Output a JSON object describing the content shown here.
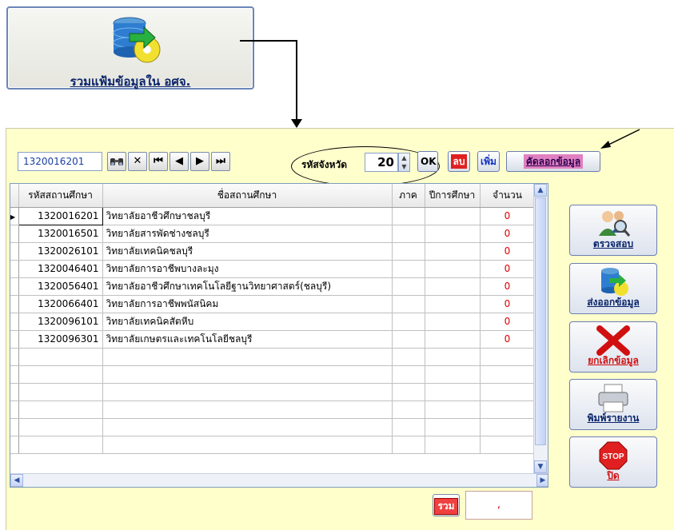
{
  "top_button": {
    "label": "รวมแฟ้มข้อมูลใน อศจ.",
    "icon": "database-export-icon"
  },
  "toolbar": {
    "record_value": "1320016201",
    "find_icon": "binoculars-icon",
    "delete_icon": "x-icon",
    "first_icon": "first-record-icon",
    "prev_icon": "prev-record-icon",
    "next_icon": "next-record-icon",
    "last_icon": "last-record-icon",
    "province_label": "รหัสจังหวัด",
    "province_value": "20",
    "ok_label": "OK",
    "delete_label": "ลบ",
    "add_label": "เพิ่ม",
    "export_label": "คัดลอกข้อมูล"
  },
  "grid": {
    "columns": [
      "รหัสสถานศึกษา",
      "ชื่อสถานศึกษา",
      "ภาค",
      "ปีการศึกษา",
      "จำนวน"
    ],
    "rows": [
      {
        "code": "1320016201",
        "name": "วิทยาลัยอาชีวศึกษาชลบุรี",
        "region": "",
        "year": "",
        "count": "0"
      },
      {
        "code": "1320016501",
        "name": "วิทยาลัยสารพัดช่างชลบุรี",
        "region": "",
        "year": "",
        "count": "0"
      },
      {
        "code": "1320026101",
        "name": "วิทยาลัยเทคนิคชลบุรี",
        "region": "",
        "year": "",
        "count": "0"
      },
      {
        "code": "1320046401",
        "name": "วิทยาลัยการอาชีพบางละมุง",
        "region": "",
        "year": "",
        "count": "0"
      },
      {
        "code": "1320056401",
        "name": "วิทยาลัยอาชีวศึกษาเทคโนโลยีฐานวิทยาศาสตร์(ชลบุรี)",
        "region": "",
        "year": "",
        "count": "0"
      },
      {
        "code": "1320066401",
        "name": "วิทยาลัยการอาชีพพนัสนิคม",
        "region": "",
        "year": "",
        "count": "0"
      },
      {
        "code": "1320096101",
        "name": "วิทยาลัยเทคนิคสัตหีบ",
        "region": "",
        "year": "",
        "count": "0"
      },
      {
        "code": "1320096301",
        "name": "วิทยาลัยเกษตรและเทคโนโลยีชลบุรี",
        "region": "",
        "year": "",
        "count": "0"
      }
    ]
  },
  "side_buttons": [
    {
      "label": "ตรวจสอบ",
      "icon": "users-search-icon"
    },
    {
      "label": "ส่งออกข้อมูล",
      "icon": "database-export-icon"
    },
    {
      "label": "ยกเลิกข้อมูล",
      "icon": "red-x-icon"
    },
    {
      "label": "พิมพ์รายงาน",
      "icon": "printer-icon"
    },
    {
      "label": "ปิด",
      "icon": "stop-sign-icon"
    }
  ],
  "footer": {
    "sum_label": "รวม",
    "sum_value": ","
  },
  "colors": {
    "panel_bg": "#ffffcc",
    "accent": "#0a246a",
    "count_red": "#e00000"
  }
}
